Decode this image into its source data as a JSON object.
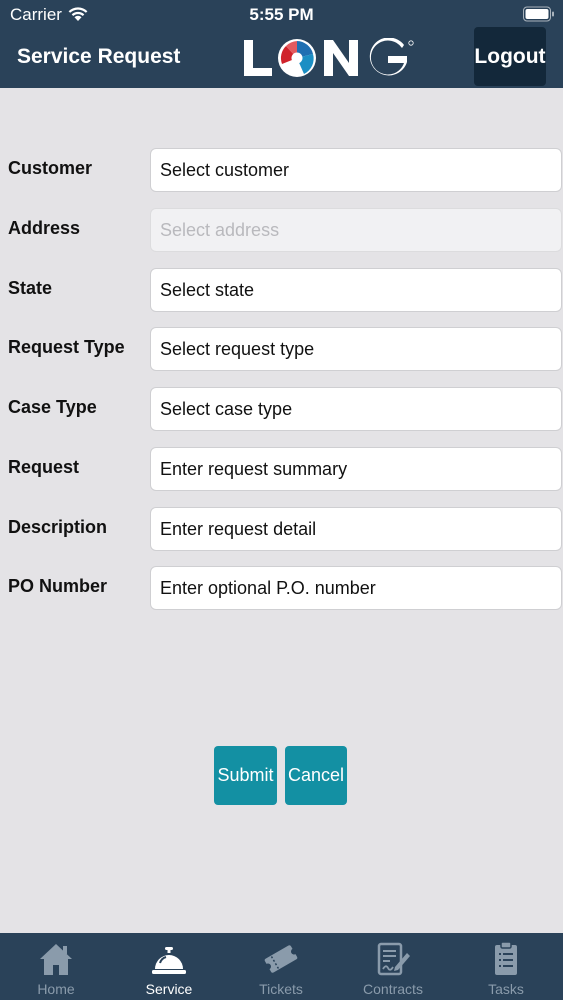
{
  "status": {
    "carrier": "Carrier",
    "time": "5:55 PM"
  },
  "header": {
    "title": "Service Request",
    "logo_text": "LONG",
    "logout_label": "Logout"
  },
  "form": {
    "customer": {
      "label": "Customer",
      "value": "Select customer"
    },
    "address": {
      "label": "Address",
      "value": "Select address"
    },
    "state": {
      "label": "State",
      "value": "Select state"
    },
    "request_type": {
      "label": "Request Type",
      "value": "Select request type"
    },
    "case_type": {
      "label": "Case Type",
      "value": "Select case type"
    },
    "request": {
      "label": "Request",
      "placeholder": "Enter request summary"
    },
    "description": {
      "label": "Description",
      "placeholder": "Enter request detail"
    },
    "po_number": {
      "label": "PO Number",
      "placeholder": "Enter optional P.O. number"
    }
  },
  "actions": {
    "submit_label": "Submit",
    "cancel_label": "Cancel"
  },
  "tabs": {
    "home": {
      "label": "Home",
      "icon": "home-icon"
    },
    "service": {
      "label": "Service",
      "icon": "service-bell-icon"
    },
    "tickets": {
      "label": "Tickets",
      "icon": "tickets-icon"
    },
    "contracts": {
      "label": "Contracts",
      "icon": "contract-icon"
    },
    "tasks": {
      "label": "Tasks",
      "icon": "clipboard-icon"
    }
  },
  "colors": {
    "header_bg": "#2a4259",
    "accent": "#1390a3",
    "page_bg": "#e4e3e6"
  }
}
